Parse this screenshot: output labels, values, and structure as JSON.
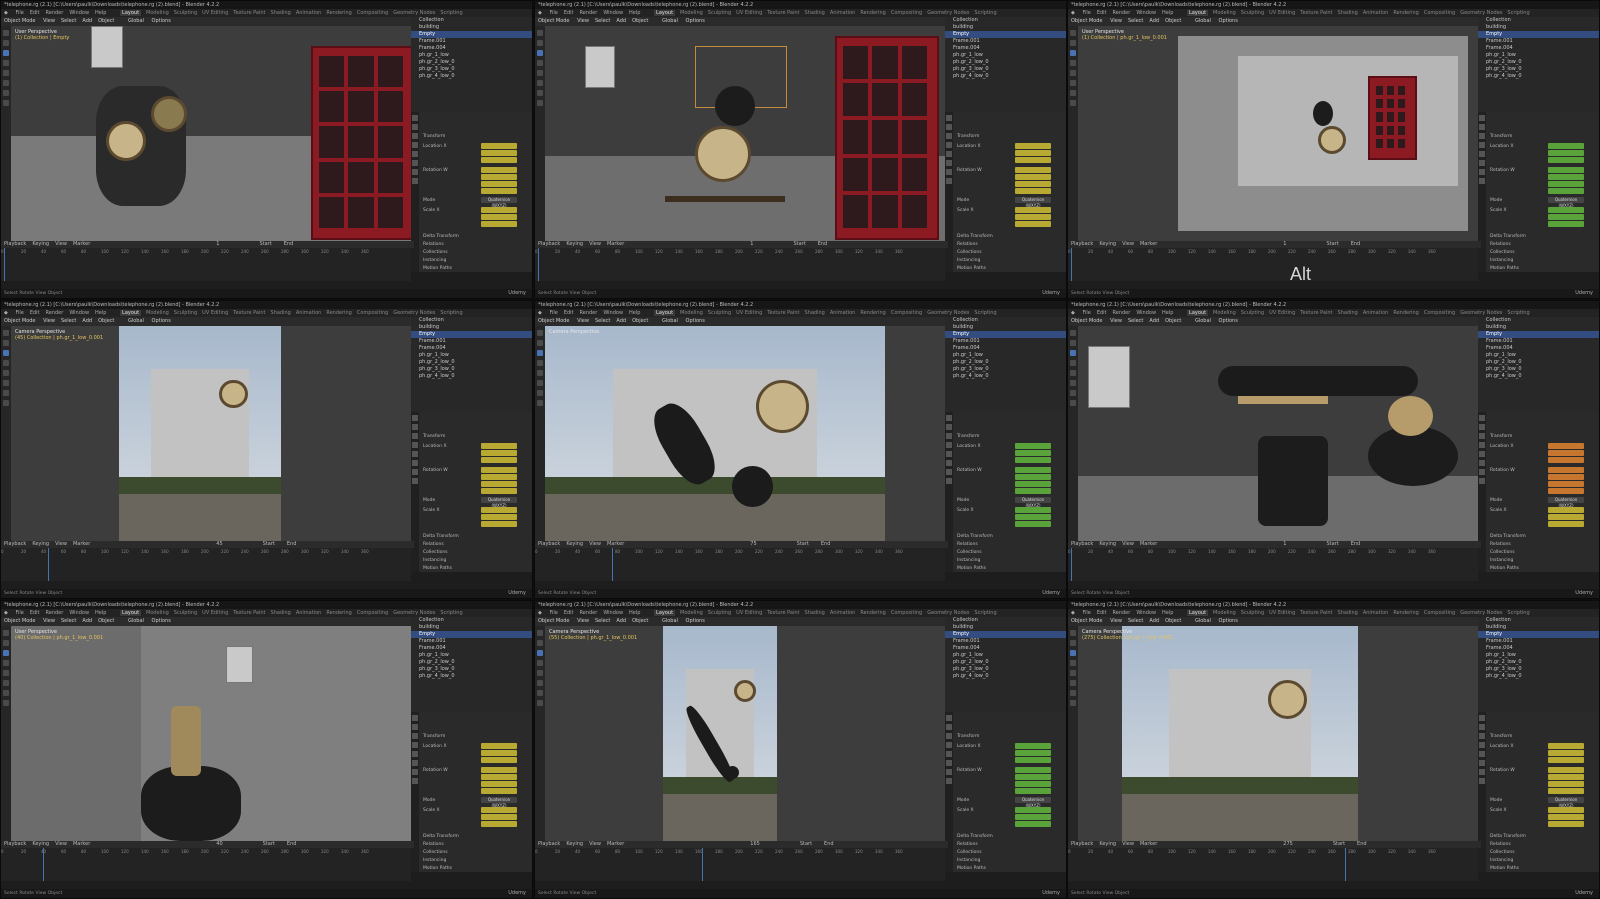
{
  "window": {
    "title": "*telephone.rg (2.1) [C:\\Users\\paulk\\Downloads\\telephone.rg (2).blend] - Blender 4.2.2",
    "menus": [
      "File",
      "Edit",
      "Render",
      "Window",
      "Help"
    ],
    "workspaces": [
      "Layout",
      "Modeling",
      "Sculpting",
      "UV Editing",
      "Texture Paint",
      "Shading",
      "Animation",
      "Rendering",
      "Compositing",
      "Geometry Nodes",
      "Scripting"
    ],
    "active_workspace": "Layout"
  },
  "viewport_header": {
    "mode": "Object Mode",
    "menus": [
      "View",
      "Select",
      "Add",
      "Object"
    ],
    "orientation": "Global",
    "options": "Options"
  },
  "panes": [
    {
      "label": "User Perspective",
      "collection": "(1) Collection | Empty",
      "scene": "phone-closeup",
      "playhead_frame": "1"
    },
    {
      "label": "",
      "collection": "",
      "scene": "phone-booth",
      "playhead_frame": "1"
    },
    {
      "label": "User Perspective",
      "collection": "(1) Collection | ph.gr_1_low_0.001",
      "scene": "room-wide",
      "playhead_frame": "1"
    },
    {
      "label": "Camera Perspective",
      "collection": "(45) Collection | ph.gr_1_low_0.001",
      "scene": "photo-building",
      "playhead_frame": "45"
    },
    {
      "label": "Camera Perspective",
      "collection": "",
      "scene": "photo-receiver",
      "playhead_frame": "75"
    },
    {
      "label": "",
      "collection": "",
      "scene": "receiver-closeup",
      "playhead_frame": "1"
    },
    {
      "label": "User Perspective",
      "collection": "(40) Collection | ph.gr_1_low_0.001",
      "scene": "phone-dark",
      "playhead_frame": "40"
    },
    {
      "label": "Camera Perspective",
      "collection": "(55) Collection | ph.gr_1_low_0.001",
      "scene": "photo-tall",
      "playhead_frame": "165"
    },
    {
      "label": "Camera Perspective",
      "collection": "(275) Collection | ph.gr_1_low_0.001",
      "scene": "photo-final",
      "playhead_frame": "275"
    }
  ],
  "outliner_items": [
    "Collection",
    "building",
    "Empty",
    "Frame.001",
    "Frame.004",
    "ph.gr_1_low",
    "ph.gr_2_low_0",
    "ph.gr_3_low_0",
    "ph.gr_4_low_0"
  ],
  "properties": {
    "section": "Transform",
    "location_label": "Location X",
    "rotation_label": "Rotation W",
    "mode_label": "Mode",
    "mode_value": "Quaternion (WXYZ)",
    "scale_label": "Scale X",
    "delta_label": "Delta Transform",
    "relations_label": "Relations",
    "collections_label": "Collections",
    "instancing_label": "Instancing",
    "motion_paths_label": "Motion Paths"
  },
  "timeline": {
    "menus": [
      "Playback",
      "Keying",
      "View",
      "Marker"
    ],
    "start_label": "Start",
    "end_label": "End",
    "ticks": [
      "0",
      "20",
      "40",
      "60",
      "80",
      "100",
      "120",
      "140",
      "160",
      "180",
      "200",
      "220",
      "240",
      "260",
      "280",
      "300",
      "320",
      "340",
      "360"
    ]
  },
  "statusbar": {
    "left": "Select   Rotate View   Object",
    "brand": "Udemy"
  },
  "overlay_text": "Alt",
  "colors": {
    "accent": "#4772b3",
    "keyframe_yellow": "#b8a933",
    "keyframe_green": "#5aa33a",
    "keyframe_orange": "#c6762e",
    "booth_red": "#8b1a23"
  }
}
